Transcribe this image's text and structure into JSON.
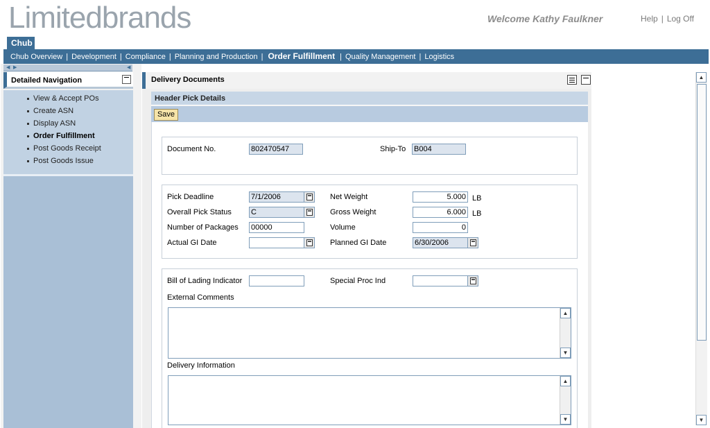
{
  "header": {
    "logo_part1": "Limited",
    "logo_part2": "brands",
    "welcome": "Welcome Kathy Faulkner",
    "help": "Help",
    "logoff": "Log Off"
  },
  "topnav": {
    "tab": "Chub",
    "items": [
      "Chub Overview",
      "Development",
      "Compliance",
      "Planning and Production",
      "Order Fulfillment",
      "Quality Management",
      "Logistics"
    ]
  },
  "leftnav": {
    "title": "Detailed Navigation",
    "items": [
      "View & Accept POs",
      "Create ASN",
      "Display ASN",
      "Order Fulfillment",
      "Post Goods Receipt",
      "Post Goods Issue"
    ]
  },
  "main": {
    "title": "Delivery Documents",
    "section_title": "Header Pick Details",
    "save": "Save"
  },
  "form": {
    "document_no_label": "Document No.",
    "document_no": "802470547",
    "ship_to_label": "Ship-To",
    "ship_to": "B004",
    "pick_deadline_label": "Pick Deadline",
    "pick_deadline": "7/1/2006",
    "net_weight_label": "Net Weight",
    "net_weight": "5.000",
    "net_weight_unit": "LB",
    "overall_pick_status_label": "Overall Pick Status",
    "overall_pick_status": "C",
    "gross_weight_label": "Gross Weight",
    "gross_weight": "6.000",
    "gross_weight_unit": "LB",
    "num_packages_label": "Number of Packages",
    "num_packages": "00000",
    "volume_label": "Volume",
    "volume": "0",
    "actual_gi_label": "Actual GI Date",
    "actual_gi": "",
    "planned_gi_label": "Planned GI Date",
    "planned_gi": "6/30/2006",
    "bol_label": "Bill of Lading Indicator",
    "bol": "",
    "special_proc_label": "Special Proc Ind",
    "special_proc": "",
    "external_comments_label": "External Comments",
    "external_comments": "",
    "delivery_info_label": "Delivery Information",
    "delivery_info": ""
  }
}
